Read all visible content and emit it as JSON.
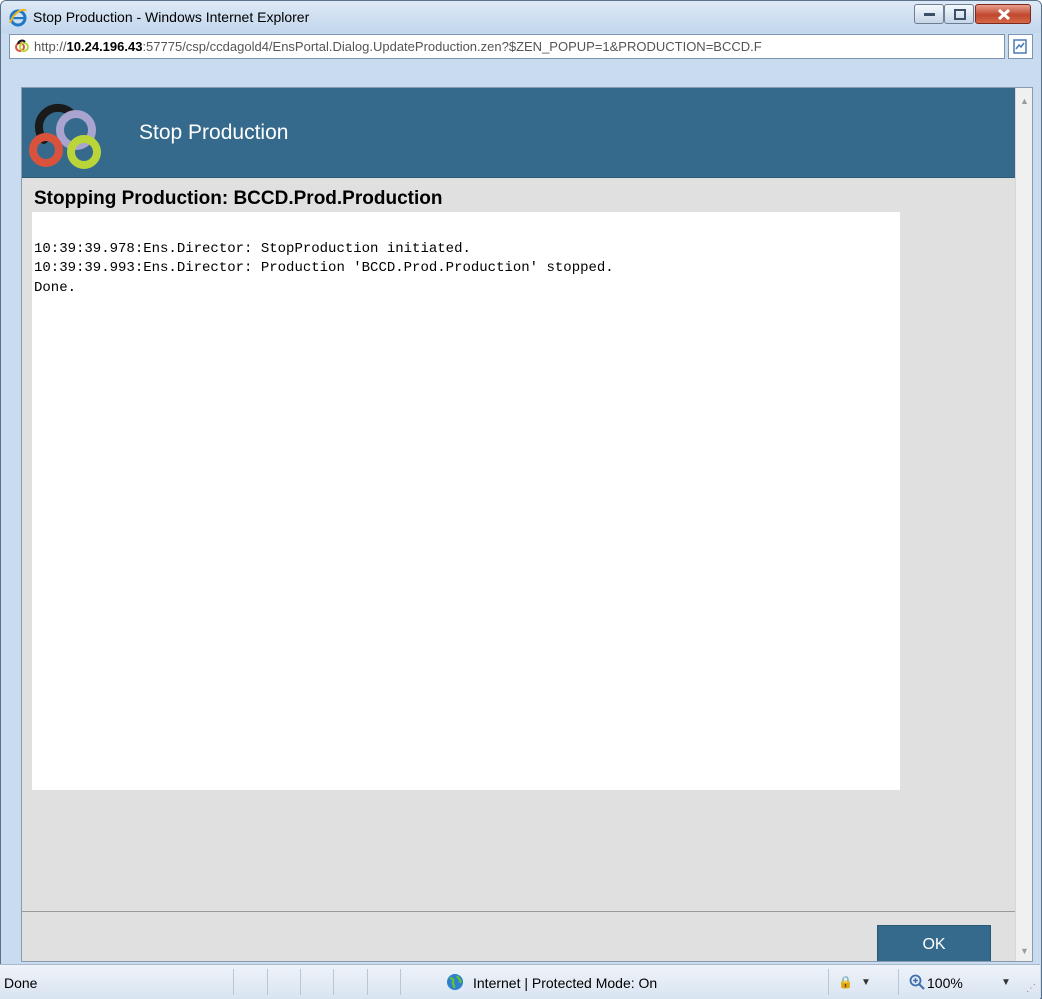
{
  "window": {
    "title": "Stop Production - Windows Internet Explorer",
    "url_prefix": "http://",
    "url_host": "10.24.196.43",
    "url_rest": ":57775/csp/ccdagold4/EnsPortal.Dialog.UpdateProduction.zen?$ZEN_POPUP=1&PRODUCTION=BCCD.F"
  },
  "dialog": {
    "header_title": "Stop Production",
    "subtitle": "Stopping Production:  BCCD.Prod.Production",
    "log_lines": [
      "10:39:39.978:Ens.Director: StopProduction initiated.",
      "10:39:39.993:Ens.Director: Production 'BCCD.Prod.Production' stopped.",
      "Done."
    ],
    "ok_label": "OK"
  },
  "statusbar": {
    "status": "Done",
    "zone": "Internet | Protected Mode: On",
    "zoom": "100%"
  },
  "colors": {
    "header_bg": "#356a8c",
    "panel_bg": "#e0e0e0",
    "logo_black": "#1a1a1a",
    "logo_red": "#d9533c",
    "logo_lavender": "#a9a3cf",
    "logo_green": "#b9d53a"
  }
}
